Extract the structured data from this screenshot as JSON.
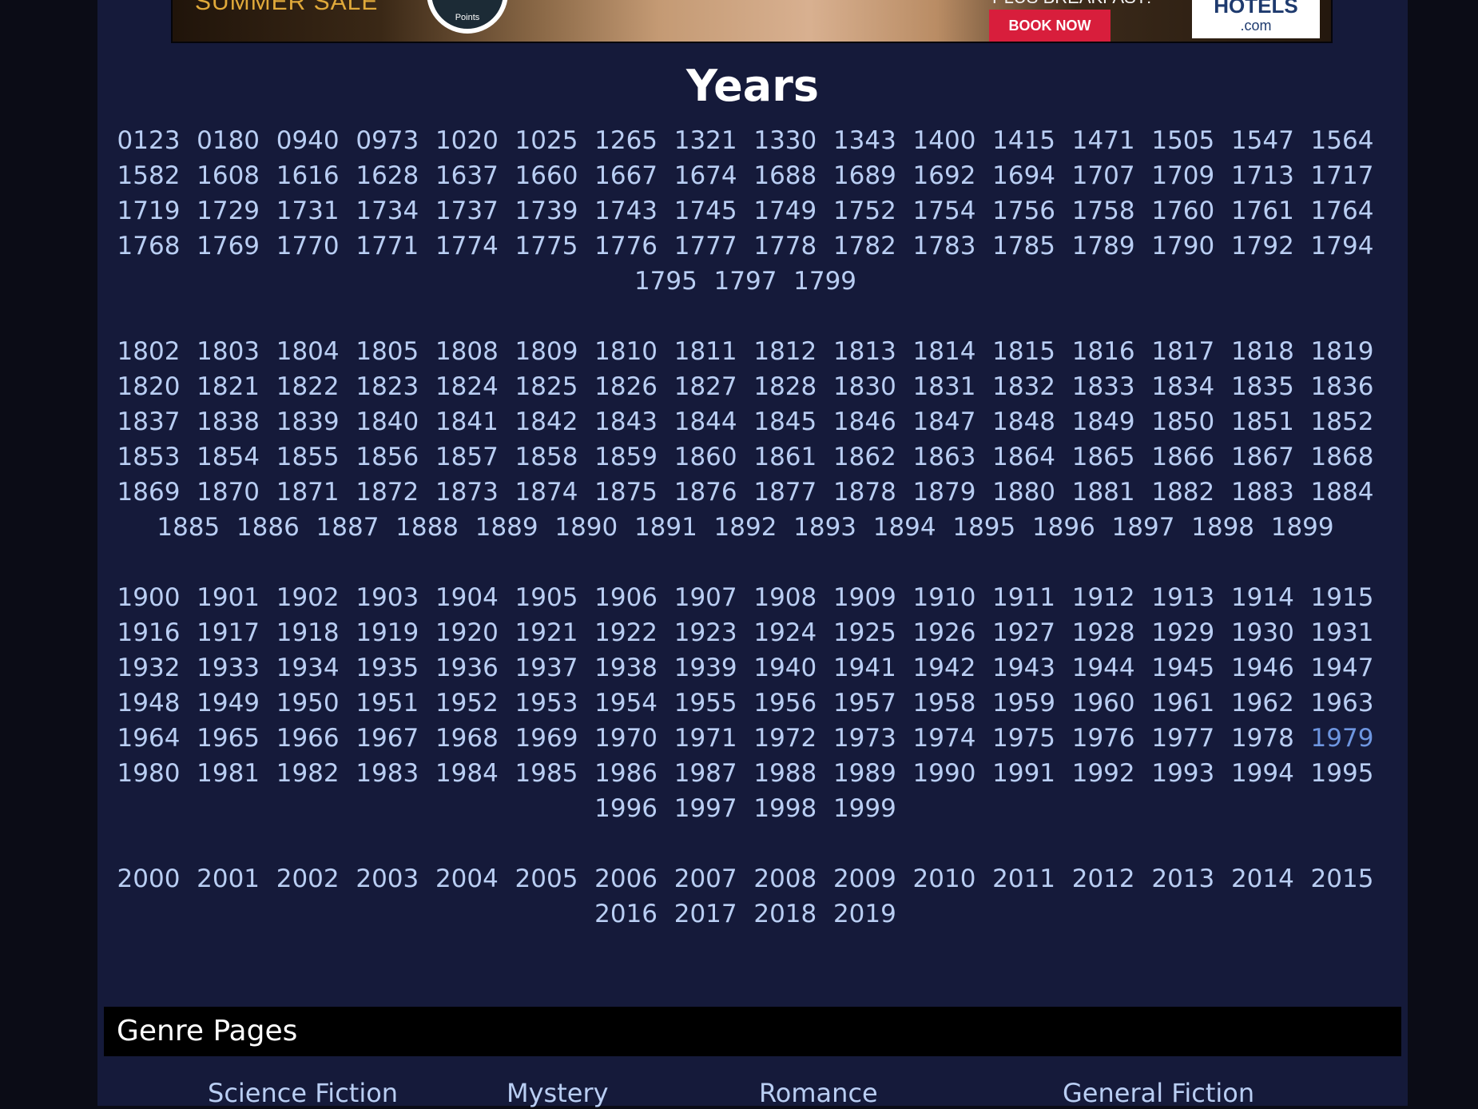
{
  "ad": {
    "sale_text": "SUMMER SALE",
    "badge_text": "Points",
    "breakfast_text": "PLUS BREAKFAST!",
    "book_now": "BOOK NOW",
    "brand_top": "HOTELS",
    "brand_bottom": ".com"
  },
  "years": {
    "title": "Years",
    "groups": [
      [
        "0123",
        "0180",
        "0940",
        "0973",
        "1020",
        "1025",
        "1265",
        "1321",
        "1330",
        "1343",
        "1400",
        "1415",
        "1471",
        "1505",
        "1547",
        "1564",
        "1582",
        "1608",
        "1616",
        "1628",
        "1637",
        "1660",
        "1667",
        "1674",
        "1688",
        "1689",
        "1692",
        "1694",
        "1707",
        "1709",
        "1713",
        "1717",
        "1719",
        "1729",
        "1731",
        "1734",
        "1737",
        "1739",
        "1743",
        "1745",
        "1749",
        "1752",
        "1754",
        "1756",
        "1758",
        "1760",
        "1761",
        "1764",
        "1768",
        "1769",
        "1770",
        "1771",
        "1774",
        "1775",
        "1776",
        "1777",
        "1778",
        "1782",
        "1783",
        "1785",
        "1789",
        "1790",
        "1792",
        "1794",
        "1795",
        "1797",
        "1799"
      ],
      [
        "1802",
        "1803",
        "1804",
        "1805",
        "1808",
        "1809",
        "1810",
        "1811",
        "1812",
        "1813",
        "1814",
        "1815",
        "1816",
        "1817",
        "1818",
        "1819",
        "1820",
        "1821",
        "1822",
        "1823",
        "1824",
        "1825",
        "1826",
        "1827",
        "1828",
        "1830",
        "1831",
        "1832",
        "1833",
        "1834",
        "1835",
        "1836",
        "1837",
        "1838",
        "1839",
        "1840",
        "1841",
        "1842",
        "1843",
        "1844",
        "1845",
        "1846",
        "1847",
        "1848",
        "1849",
        "1850",
        "1851",
        "1852",
        "1853",
        "1854",
        "1855",
        "1856",
        "1857",
        "1858",
        "1859",
        "1860",
        "1861",
        "1862",
        "1863",
        "1864",
        "1865",
        "1866",
        "1867",
        "1868",
        "1869",
        "1870",
        "1871",
        "1872",
        "1873",
        "1874",
        "1875",
        "1876",
        "1877",
        "1878",
        "1879",
        "1880",
        "1881",
        "1882",
        "1883",
        "1884",
        "1885",
        "1886",
        "1887",
        "1888",
        "1889",
        "1890",
        "1891",
        "1892",
        "1893",
        "1894",
        "1895",
        "1896",
        "1897",
        "1898",
        "1899"
      ],
      [
        "1900",
        "1901",
        "1902",
        "1903",
        "1904",
        "1905",
        "1906",
        "1907",
        "1908",
        "1909",
        "1910",
        "1911",
        "1912",
        "1913",
        "1914",
        "1915",
        "1916",
        "1917",
        "1918",
        "1919",
        "1920",
        "1921",
        "1922",
        "1923",
        "1924",
        "1925",
        "1926",
        "1927",
        "1928",
        "1929",
        "1930",
        "1931",
        "1932",
        "1933",
        "1934",
        "1935",
        "1936",
        "1937",
        "1938",
        "1939",
        "1940",
        "1941",
        "1942",
        "1943",
        "1944",
        "1945",
        "1946",
        "1947",
        "1948",
        "1949",
        "1950",
        "1951",
        "1952",
        "1953",
        "1954",
        "1955",
        "1956",
        "1957",
        "1958",
        "1959",
        "1960",
        "1961",
        "1962",
        "1963",
        "1964",
        "1965",
        "1966",
        "1967",
        "1968",
        "1969",
        "1970",
        "1971",
        "1972",
        "1973",
        "1974",
        "1975",
        "1976",
        "1977",
        "1978",
        "1979",
        "1980",
        "1981",
        "1982",
        "1983",
        "1984",
        "1985",
        "1986",
        "1987",
        "1988",
        "1989",
        "1990",
        "1991",
        "1992",
        "1993",
        "1994",
        "1995",
        "1996",
        "1997",
        "1998",
        "1999"
      ],
      [
        "2000",
        "2001",
        "2002",
        "2003",
        "2004",
        "2005",
        "2006",
        "2007",
        "2008",
        "2009",
        "2010",
        "2011",
        "2012",
        "2013",
        "2014",
        "2015",
        "2016",
        "2017",
        "2018",
        "2019"
      ]
    ],
    "visited": [
      "1979"
    ]
  },
  "genre": {
    "title": "Genre Pages",
    "links": [
      "Science Fiction",
      "Mystery",
      "Romance",
      "General Fiction"
    ]
  },
  "colors": {
    "page_background": "#151a3a",
    "outer_background": "#0b0c16",
    "link": "#b9cef3",
    "visited_link": "#6e96e0",
    "heading": "#ffffff",
    "genre_bar": "#000000",
    "book_now_button": "#d81e3c"
  }
}
